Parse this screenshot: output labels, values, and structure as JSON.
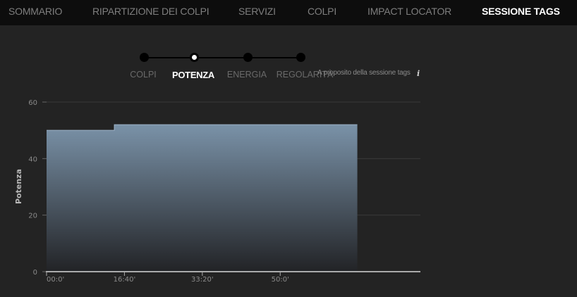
{
  "nav": {
    "tabs": [
      {
        "label": "SOMMARIO",
        "active": false
      },
      {
        "label": "RIPARTIZIONE DEI COLPI",
        "active": false
      },
      {
        "label": "SERVIZI",
        "active": false
      },
      {
        "label": "COLPI",
        "active": false
      },
      {
        "label": "IMPACT LOCATOR",
        "active": false
      },
      {
        "label": "SESSIONE TAGS",
        "active": true
      }
    ]
  },
  "stepper": {
    "steps": [
      {
        "label": "COLPI",
        "active": false
      },
      {
        "label": "POTENZA",
        "active": true
      },
      {
        "label": "ENERGIA",
        "active": false
      },
      {
        "label": "REGOLARITÀ",
        "active": false
      }
    ]
  },
  "about_label": "A proposito della sessione tags",
  "info_icon": "i",
  "colors": {
    "background": "#232323",
    "nav_background": "#0d0d0d",
    "area_top": "#7a92a8",
    "area_bottom": "#222326",
    "area_edge": "#9db2c6",
    "grid": "#3a3a3a"
  },
  "chart_data": {
    "type": "area",
    "ylabel": "Potenza",
    "ylim": [
      0,
      60
    ],
    "yticks": [
      0,
      20,
      40,
      60
    ],
    "xlim_minutes": [
      0,
      80
    ],
    "xticks": [
      {
        "minutes": 0,
        "label": "00:0'"
      },
      {
        "minutes": 16.667,
        "label": "16:40'"
      },
      {
        "minutes": 33.333,
        "label": "33:20'"
      },
      {
        "minutes": 50,
        "label": "50:0'"
      }
    ],
    "grid": "horizontal",
    "series": [
      {
        "x_minutes": [
          0,
          14.5,
          14.5,
          66.5
        ],
        "values": [
          50,
          50,
          52,
          52
        ],
        "step": true
      }
    ]
  }
}
